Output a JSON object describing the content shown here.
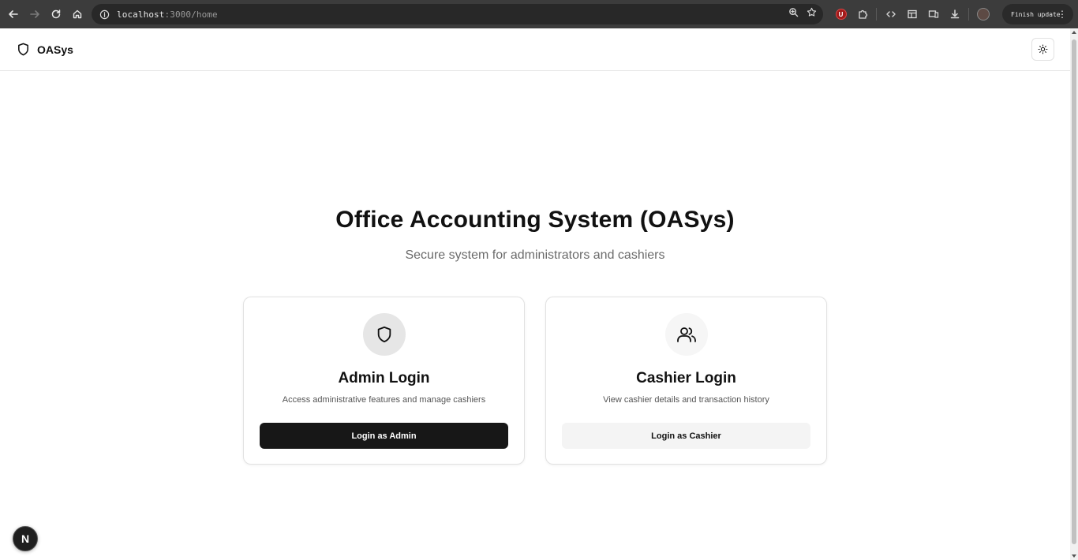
{
  "browser": {
    "url_host": "localhost",
    "url_rest": ":3000/home",
    "update_label": "Finish update",
    "extension_badge": "U"
  },
  "header": {
    "brand": "OASys"
  },
  "hero": {
    "title": "Office Accounting System (OASys)",
    "subtitle": "Secure system for administrators and cashiers"
  },
  "cards": {
    "admin": {
      "title": "Admin Login",
      "description": "Access administrative features and manage cashiers",
      "button_label": "Login as Admin",
      "icon": "shield-icon"
    },
    "cashier": {
      "title": "Cashier Login",
      "description": "View cashier details and transaction history",
      "button_label": "Login as Cashier",
      "icon": "users-icon"
    }
  },
  "dev_badge": {
    "label": "N"
  },
  "colors": {
    "primary_button": "#171717",
    "secondary_button": "#f4f4f4",
    "muted_text": "#6b6b6b",
    "browser_chrome": "#3c3c3c"
  }
}
